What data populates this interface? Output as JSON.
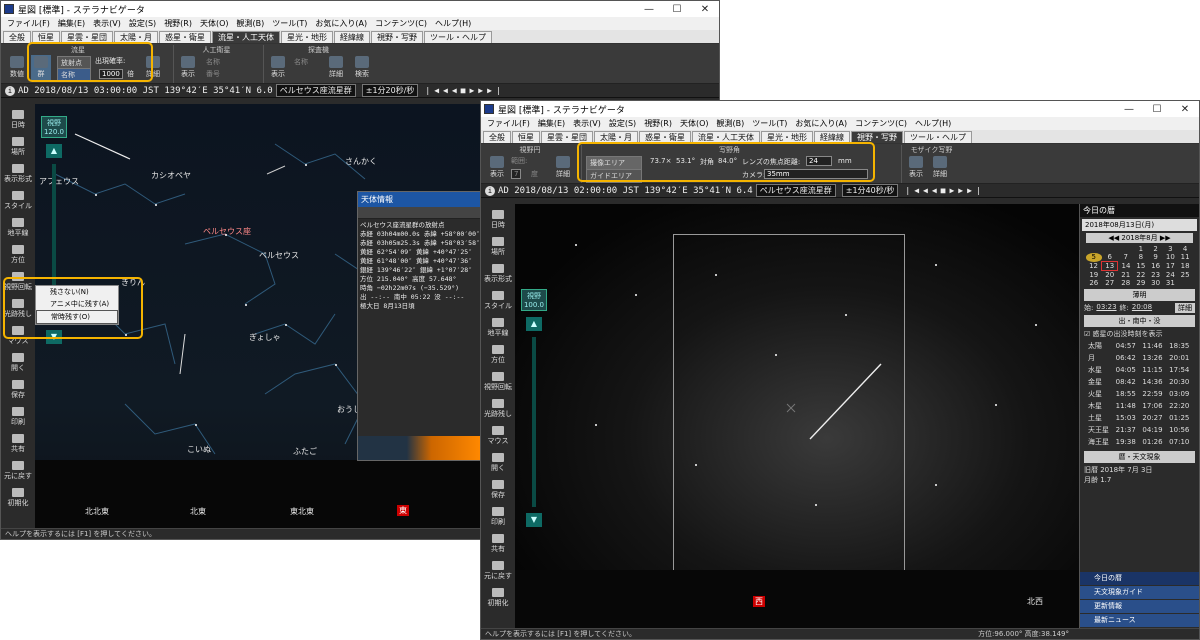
{
  "app_title": "星図 [標準] - ステラナビゲータ",
  "window_controls": {
    "min": "—",
    "max": "☐",
    "close": "✕"
  },
  "menu": [
    "ファイル(F)",
    "編集(E)",
    "表示(V)",
    "設定(S)",
    "視野(R)",
    "天体(O)",
    "観測(B)",
    "ツール(T)",
    "お気に入り(A)",
    "コンテンツ(C)",
    "ヘルプ(H)"
  ],
  "tabs": [
    "全般",
    "恒星",
    "星雲・星団",
    "太陽・月",
    "惑星・衛星",
    "流星・人工天体",
    "星光・地形",
    "経緯線",
    "視野・写野",
    "ツール・ヘルプ"
  ],
  "w1": {
    "ribbon": {
      "group1_title": "流星",
      "count_btn": "数値",
      "radiant_btn": "群",
      "radiant_pt": "放射点",
      "name_btn": "名称",
      "rate_label": "出現確率:",
      "rate_value": "1000",
      "rate_unit": "倍",
      "detail": "詳細",
      "group2_title": "人工衛星",
      "show": "表示",
      "name2": "名称",
      "orbit": "番号",
      "group3_title": "探査機",
      "show3": "表示",
      "name3": "名称",
      "detail3": "詳細",
      "search": "検索"
    },
    "status": {
      "ad": "AD",
      "date": "2018/08/13 03:00:00",
      "jst": "JST",
      "lon": "139°42′E",
      "lat": "35°41′N",
      "fov": "6.0",
      "combo": "ペルセウス座流星群",
      "speed": "±1分20秒/秒"
    },
    "left": [
      "日時",
      "場所",
      "表示形式",
      "スタイル",
      "地平線",
      "方位",
      "視野回転",
      "光跡残し",
      "マウス",
      "開く",
      "保存",
      "印刷",
      "共有",
      "元に戻す",
      "初期化"
    ],
    "zoom": {
      "label": "視野",
      "value": "120.0"
    },
    "sky_labels": [
      "アフェウス",
      "カシオペヤ",
      "さんかく",
      "ペルセウス座",
      "ペルセウス",
      "ぎょしゃ",
      "おうし",
      "ふたご",
      "きりん",
      "こいぬ"
    ],
    "dirs": [
      "北北東",
      "北東",
      "東北東",
      "東"
    ],
    "popup": [
      "残さない(N)",
      "アニメ中に残す(A)",
      "常時残す(O)"
    ],
    "info": {
      "title": "天体情報",
      "lines": [
        "ペルセウス座流星群の放射点",
        "赤経 03h04m00.0s 赤緯 +58°00′00″",
        "赤経 03h05m25.3s 赤緯 +58°03′58″",
        "黄経 62°54′09″ 黄緯 +40°47′25″",
        "黄経 61°48′00″ 黄緯 +40°47′36″",
        "銀経 139°46′22″ 銀緯 +1°07′28″",
        "方位 215.040° 高度 57.648°",
        "時角 −02h22m07s (−35.529°)",
        "出 --:-- 南中 05:22 没 --:--",
        "極大日 8月13日頃"
      ]
    },
    "help": "ヘルプを表示するには [F1] を押してください。"
  },
  "w2": {
    "ribbon": {
      "g1": "視野円",
      "show": "表示",
      "range": "範囲:",
      "range_val": "7",
      "unit": "度",
      "detail": "詳細",
      "g2": "写野角",
      "area": "撮像エリア",
      "guide": "ガイドエリア",
      "sz1": "73.7×",
      "sz2": "53.1°",
      "diag": "対角",
      "diag_v": "84.0°",
      "lens": "レンズの焦点距離:",
      "lens_v": "24",
      "mm": "mm",
      "camera": "カメラ:",
      "camera_v": "35mm",
      "g3": "モザイク写野",
      "show3": "表示",
      "detail3": "詳細"
    },
    "status": {
      "ad": "AD",
      "date": "2018/08/13 02:00:00",
      "jst": "JST",
      "lon": "139°42′E",
      "lat": "35°41′N",
      "fov": "6.4",
      "combo": "ペルセウス座流星群",
      "speed": "±1分40秒/秒"
    },
    "zoom": {
      "label": "視野",
      "value": "100.0"
    },
    "dirs": [
      "西",
      "北西"
    ],
    "right": {
      "title": "今日の暦",
      "date": "2018年08月13日(月)",
      "month": "2018年8月",
      "cal": [
        [
          "",
          "",
          "",
          "1",
          "2",
          "3",
          "4"
        ],
        [
          "5",
          "6",
          "7",
          "8",
          "9",
          "10",
          "11"
        ],
        [
          "12",
          "13",
          "14",
          "15",
          "16",
          "17",
          "18"
        ],
        [
          "19",
          "20",
          "21",
          "22",
          "23",
          "24",
          "25"
        ],
        [
          "26",
          "27",
          "28",
          "29",
          "30",
          "31",
          ""
        ]
      ],
      "twilight": "薄明",
      "tw_start": "始:",
      "tw_s": "03:23",
      "tw_end": "終:",
      "tw_e": "20:08",
      "detail": "詳細",
      "rise_hd": "出・南中・没",
      "chk": "惑星の出没時刻を表示",
      "planets": [
        [
          "太陽",
          "04:57",
          "11:46",
          "18:35"
        ],
        [
          "月",
          "06:42",
          "13:26",
          "20:01"
        ],
        [
          "水星",
          "04:05",
          "11:15",
          "17:54"
        ],
        [
          "金星",
          "08:42",
          "14:36",
          "20:30"
        ],
        [
          "火星",
          "18:55",
          "22:59",
          "03:09"
        ],
        [
          "木星",
          "11:48",
          "17:06",
          "22:20"
        ],
        [
          "土星",
          "15:03",
          "20:27",
          "01:25"
        ],
        [
          "天王星",
          "21:37",
          "04:19",
          "10:56"
        ],
        [
          "海王星",
          "19:38",
          "01:26",
          "07:10"
        ]
      ],
      "calendar_hd": "暦・天文現象",
      "lunar": "旧暦 2018年 7月 3日",
      "moonage": "月齢 1.7",
      "nav": [
        "今日の暦",
        "天文現象ガイド",
        "更新情報",
        "最新ニュース"
      ]
    },
    "help": "ヘルプを表示するには [F1] を押してください。",
    "coords": "方位:96.000° 高度:38.149°"
  }
}
